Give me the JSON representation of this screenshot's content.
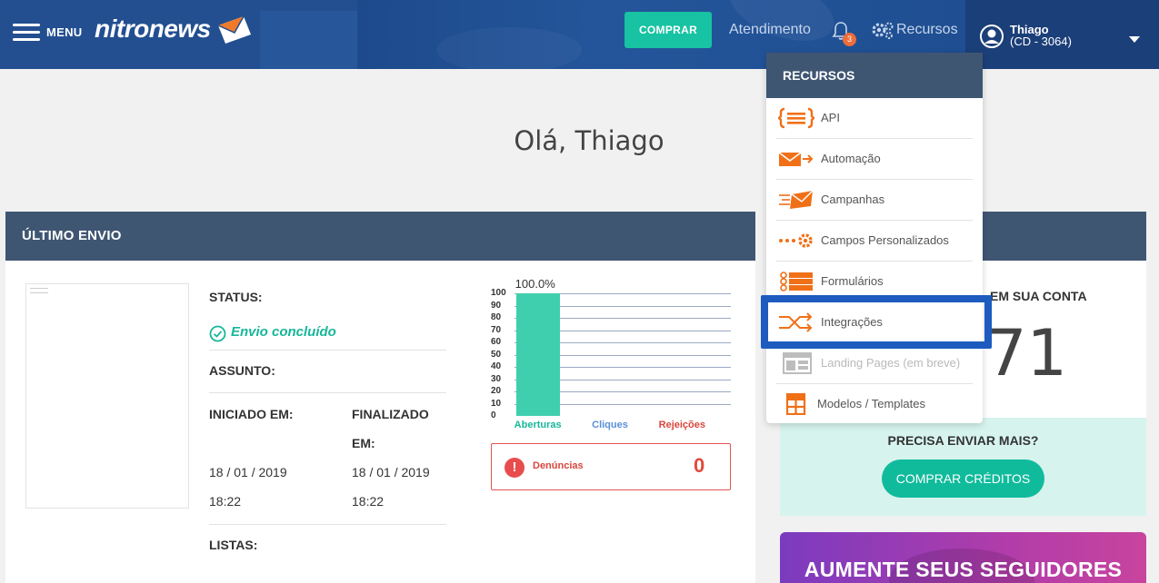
{
  "header": {
    "menu_label": "MENU",
    "logo_text": "nitronews",
    "buy_button": "COMPRAR",
    "support_link": "Atendimento",
    "notifications_count": "3",
    "resources_link": "Recursos",
    "user": {
      "name": "Thiago",
      "code": "(CD - 3064)"
    }
  },
  "greeting": "Olá, Thiago",
  "last_send": {
    "title": "ÚLTIMO ENVIO",
    "status_label": "STATUS:",
    "status_value": "Envio concluído",
    "subject_label": "ASSUNTO:",
    "started_label": "INICIADO EM:",
    "started_date": "18 / 01 / 2019",
    "started_time": "18:22",
    "finished_label_1": "FINALIZADO",
    "finished_label_2": "EM:",
    "finished_date": "18 / 01 / 2019",
    "finished_time": "18:22",
    "lists_label": "LISTAS:",
    "complaints_label": "Denúncias",
    "complaints_value": "0"
  },
  "chart_data": {
    "type": "bar",
    "categories": [
      "Aberturas",
      "Cliques",
      "Rejeições"
    ],
    "values": [
      100,
      0,
      0
    ],
    "data_labels": [
      "100.0%",
      "",
      ""
    ],
    "yticks": [
      "100",
      "90",
      "80",
      "70",
      "60",
      "50",
      "40",
      "30",
      "20",
      "10",
      "0"
    ],
    "ylim": [
      0,
      100
    ],
    "colors": {
      "Aberturas": "#17b79a",
      "Cliques": "#5b8fd6",
      "Rejeições": "#d9463e",
      "bar": "#3fcfae"
    }
  },
  "account": {
    "contacts_label_visible": "EM SUA CONTA",
    "contacts_number_visible": "71",
    "need_more": "PRECISA ENVIAR MAIS?",
    "buy_credits": "COMPRAR CRÉDITOS"
  },
  "promo": {
    "text": "AUMENTE SEUS SEGUIDORES"
  },
  "resources_menu": {
    "title": "RECURSOS",
    "items": [
      {
        "label": "API",
        "icon": "api-braces-icon",
        "disabled": false
      },
      {
        "label": "Automação",
        "icon": "automation-envelope-icon",
        "disabled": false
      },
      {
        "label": "Campanhas",
        "icon": "campaign-envelope-icon",
        "disabled": false
      },
      {
        "label": "Campos Personalizados",
        "icon": "custom-fields-gear-icon",
        "disabled": false
      },
      {
        "label": "Formulários",
        "icon": "forms-icon",
        "disabled": false
      },
      {
        "label": "Integrações",
        "icon": "integrations-shuffle-icon",
        "disabled": false
      },
      {
        "label": "Landing Pages (em breve)",
        "icon": "landing-page-icon",
        "disabled": true
      },
      {
        "label": "Modelos / Templates",
        "icon": "templates-icon",
        "disabled": false
      }
    ]
  },
  "colors": {
    "header_bg": "#1f4d8f",
    "accent_green": "#17c3a2",
    "card_header": "#3f5673",
    "icon_orange": "#f07018",
    "highlight_blue": "#1d5bbf"
  }
}
